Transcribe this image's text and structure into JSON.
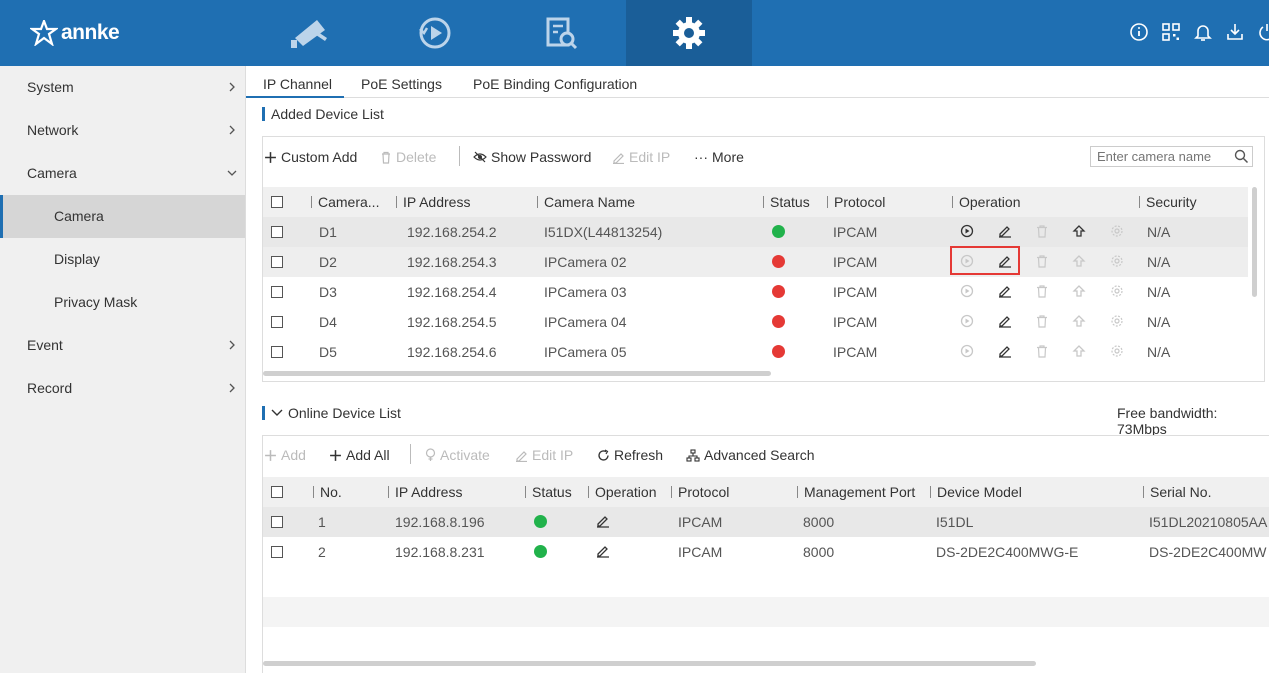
{
  "app": {
    "logo_text": "annke"
  },
  "colors": {
    "brand": "#1f6fb2",
    "ok": "#21b24b",
    "error": "#e53935"
  },
  "top_nav": [
    {
      "name": "live-view",
      "icon": "camera-icon"
    },
    {
      "name": "playback",
      "icon": "playback-icon"
    },
    {
      "name": "search",
      "icon": "file-search-icon"
    },
    {
      "name": "configuration",
      "icon": "gear-icon",
      "active": true
    }
  ],
  "top_right_icons": [
    "info-icon",
    "qr-code-icon",
    "bell-icon",
    "download-icon",
    "power-icon"
  ],
  "sidebar": {
    "items": [
      {
        "label": "System"
      },
      {
        "label": "Network"
      },
      {
        "label": "Camera",
        "expanded": true
      },
      {
        "label": "Camera",
        "sub": true,
        "active": true
      },
      {
        "label": "Display",
        "sub": true
      },
      {
        "label": "Privacy Mask",
        "sub": true
      },
      {
        "label": "Event"
      },
      {
        "label": "Record"
      }
    ]
  },
  "tabs": [
    "IP Channel",
    "PoE Settings",
    "PoE Binding Configuration"
  ],
  "added": {
    "title": "Added Device List",
    "toolbar": {
      "custom_add": "Custom Add",
      "delete": "Delete",
      "show_password": "Show Password",
      "edit_ip": "Edit IP",
      "more": "More"
    },
    "search_placeholder": "Enter camera name",
    "columns": [
      "Camera...",
      "IP Address",
      "Camera Name",
      "Status",
      "Protocol",
      "Operation",
      "Security"
    ],
    "rows": [
      {
        "no": "D1",
        "ip": "192.168.254.2",
        "name": "I51DX(L44813254)",
        "status": "ok",
        "protocol": "IPCAM",
        "security": "N/A"
      },
      {
        "no": "D2",
        "ip": "192.168.254.3",
        "name": "IPCamera 02",
        "status": "error",
        "protocol": "IPCAM",
        "security": "N/A"
      },
      {
        "no": "D3",
        "ip": "192.168.254.4",
        "name": "IPCamera 03",
        "status": "error",
        "protocol": "IPCAM",
        "security": "N/A"
      },
      {
        "no": "D4",
        "ip": "192.168.254.5",
        "name": "IPCamera 04",
        "status": "error",
        "protocol": "IPCAM",
        "security": "N/A"
      },
      {
        "no": "D5",
        "ip": "192.168.254.6",
        "name": "IPCamera 05",
        "status": "error",
        "protocol": "IPCAM",
        "security": "N/A"
      }
    ]
  },
  "online": {
    "title": "Online Device List",
    "bandwidth": "Free bandwidth: 73Mbps",
    "toolbar": {
      "add": "Add",
      "add_all": "Add All",
      "activate": "Activate",
      "edit_ip": "Edit IP",
      "refresh": "Refresh",
      "advanced_search": "Advanced Search"
    },
    "columns": [
      "No.",
      "IP Address",
      "Status",
      "Operation",
      "Protocol",
      "Management Port",
      "Device Model",
      "Serial No."
    ],
    "rows": [
      {
        "no": "1",
        "ip": "192.168.8.196",
        "status": "ok",
        "protocol": "IPCAM",
        "port": "8000",
        "model": "I51DL",
        "serial": "I51DL20210805AA"
      },
      {
        "no": "2",
        "ip": "192.168.8.231",
        "status": "ok",
        "protocol": "IPCAM",
        "port": "8000",
        "model": "DS-2DE2C400MWG-E",
        "serial": "DS-2DE2C400MW"
      }
    ]
  }
}
